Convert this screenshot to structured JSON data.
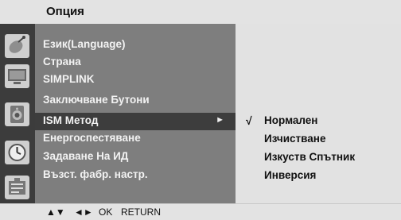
{
  "title": "Опция",
  "menu": {
    "items": [
      {
        "label": "Език(Language)"
      },
      {
        "label": "Страна"
      },
      {
        "label": "SIMPLINK"
      },
      {
        "label": "Заключване Бутони"
      },
      {
        "label": "ISM Метод",
        "selected": true,
        "arrow": "►"
      },
      {
        "label": "Енергоспестяване"
      },
      {
        "label": "Задаване На ИД"
      },
      {
        "label": "Възст. фабр. настр."
      }
    ]
  },
  "submenu": {
    "check_mark": "√",
    "options": [
      {
        "label": "Нормален",
        "checked": true
      },
      {
        "label": "Изчистване"
      },
      {
        "label": "Изкуств Спътник"
      },
      {
        "label": "Инверсия"
      }
    ]
  },
  "footer": {
    "updown": "▲▼",
    "leftright": "◄►",
    "ok": "OK",
    "return": "RETURN"
  },
  "icons": [
    "satellite-dish-icon",
    "monitor-icon",
    "speaker-icon",
    "clock-icon",
    "option-icon"
  ]
}
